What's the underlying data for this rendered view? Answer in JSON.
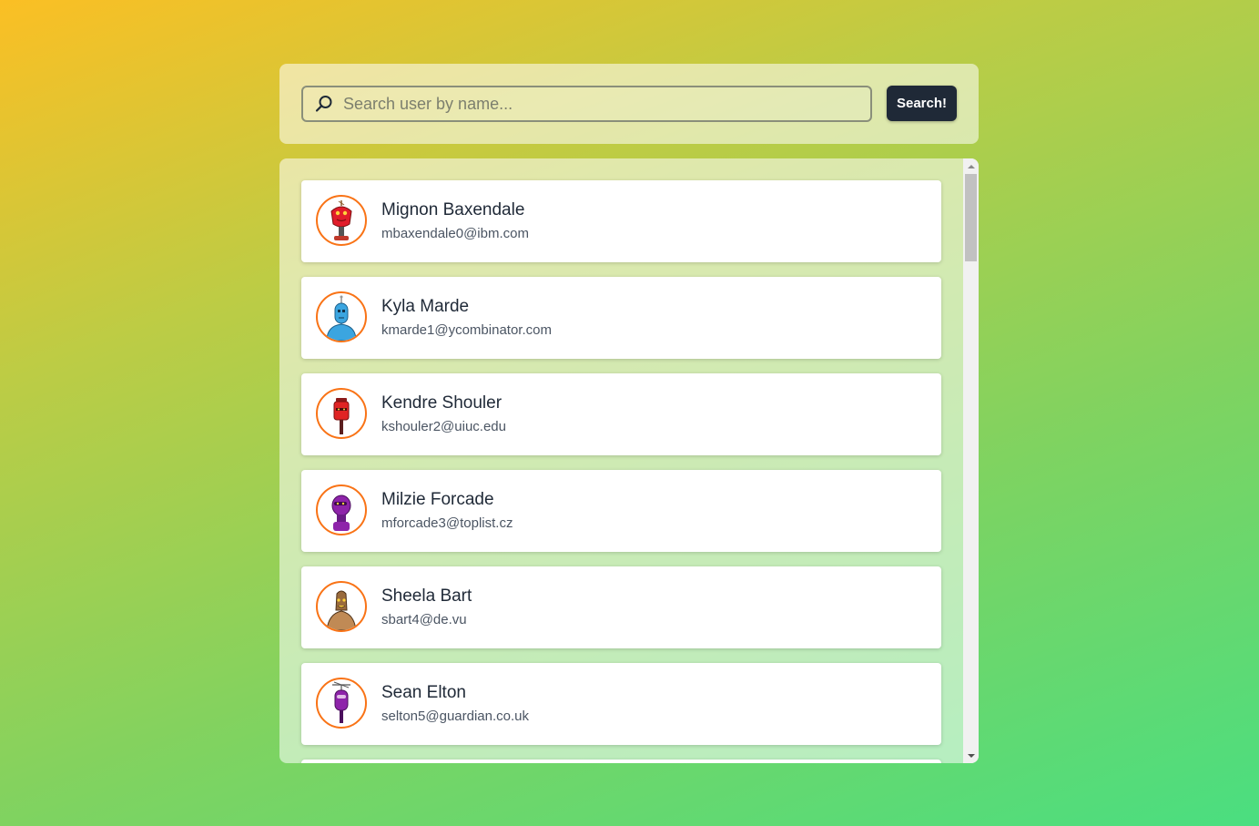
{
  "search": {
    "placeholder": "Search user by name...",
    "value": "",
    "button_label": "Search!"
  },
  "users": [
    {
      "name": "Mignon Baxendale",
      "email": "mbaxendale0@ibm.com",
      "avatar_icon": "robot-red-icon"
    },
    {
      "name": "Kyla Marde",
      "email": "kmarde1@ycombinator.com",
      "avatar_icon": "robot-blue-icon"
    },
    {
      "name": "Kendre Shouler",
      "email": "kshouler2@uiuc.edu",
      "avatar_icon": "robot-red-canister-icon"
    },
    {
      "name": "Milzie Forcade",
      "email": "mforcade3@toplist.cz",
      "avatar_icon": "robot-purple-icon"
    },
    {
      "name": "Sheela Bart",
      "email": "sbart4@de.vu",
      "avatar_icon": "robot-brown-icon"
    },
    {
      "name": "Sean Elton",
      "email": "selton5@guardian.co.uk",
      "avatar_icon": "robot-purple-antenna-icon"
    }
  ],
  "colors": {
    "avatar_border": "#f97316",
    "button_bg": "#1f2937",
    "gradient_start": "#fbbf24",
    "gradient_end": "#4ade80"
  }
}
